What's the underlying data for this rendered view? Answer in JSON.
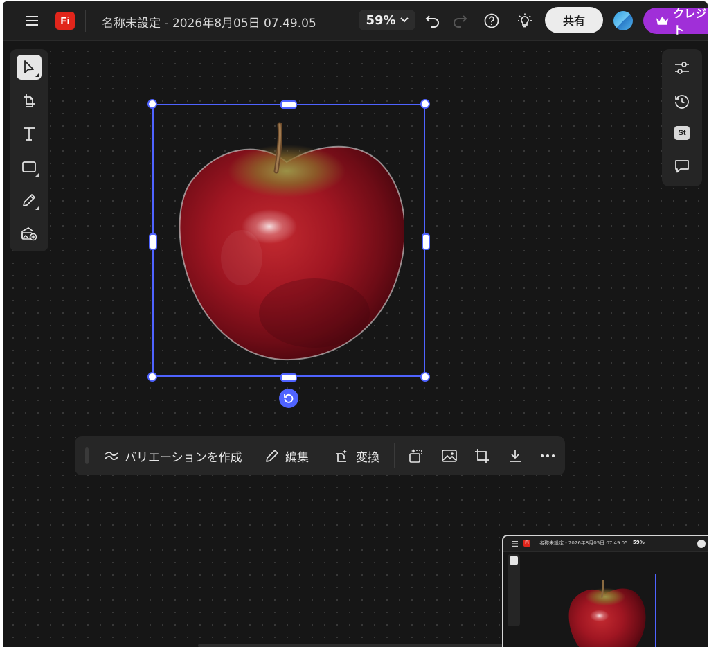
{
  "topbar": {
    "logo_text": "Fi",
    "document_title": "名称未設定 - 2026年8月05日 07.49.05",
    "zoom_value": "59%",
    "share_label": "共有",
    "premium_label": "クレジット"
  },
  "left_tools": [
    {
      "name": "select-tool",
      "icon": "cursor-icon"
    },
    {
      "name": "frame-tool",
      "icon": "frame-icon"
    },
    {
      "name": "text-tool",
      "icon": "text-icon"
    },
    {
      "name": "shape-tool",
      "icon": "rectangle-icon"
    },
    {
      "name": "draw-tool",
      "icon": "pencil-icon"
    },
    {
      "name": "add-image-tool",
      "icon": "image-add-icon"
    }
  ],
  "right_tools": [
    {
      "name": "adjust-panel",
      "icon": "sliders-icon"
    },
    {
      "name": "history-panel",
      "icon": "history-icon"
    },
    {
      "name": "stock-panel",
      "icon": "stock-icon",
      "badge": "St"
    },
    {
      "name": "comments-panel",
      "icon": "comment-icon"
    }
  ],
  "context_bar": {
    "variation_label": "バリエーションを作成",
    "edit_label": "編集",
    "transform_label": "変換"
  },
  "minimap": {
    "logo_text": "Fi",
    "document_title": "名称未設定 - 2026年8月05日 07.49.05",
    "zoom_value": "59%"
  },
  "colors": {
    "selection": "#4f63ff",
    "premium": "#a02fd8",
    "logo": "#e1251b"
  }
}
